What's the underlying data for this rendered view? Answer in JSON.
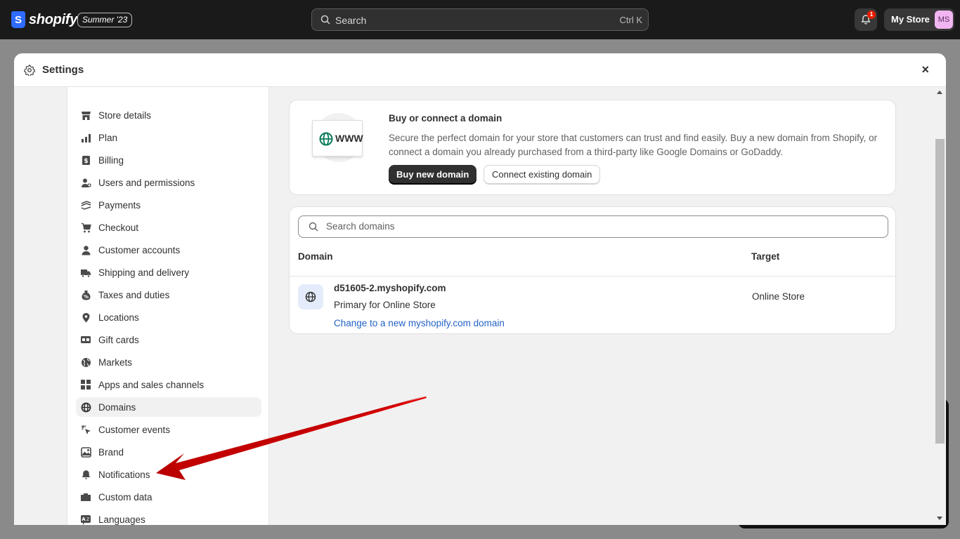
{
  "topbar": {
    "logo_mark": "S",
    "logo_text": "shopify",
    "edition": "Summer '23",
    "search_placeholder": "Search",
    "search_shortcut": "Ctrl K",
    "notification_count": "1",
    "store_name": "My Store",
    "avatar_initials": "MS"
  },
  "modal": {
    "title": "Settings",
    "close_label": "×"
  },
  "sidebar": {
    "items": [
      {
        "label": "Store details",
        "icon": "store-icon"
      },
      {
        "label": "Plan",
        "icon": "plan-icon"
      },
      {
        "label": "Billing",
        "icon": "billing-icon"
      },
      {
        "label": "Users and permissions",
        "icon": "users-icon"
      },
      {
        "label": "Payments",
        "icon": "payments-icon"
      },
      {
        "label": "Checkout",
        "icon": "cart-icon"
      },
      {
        "label": "Customer accounts",
        "icon": "person-icon"
      },
      {
        "label": "Shipping and delivery",
        "icon": "truck-icon"
      },
      {
        "label": "Taxes and duties",
        "icon": "tax-icon"
      },
      {
        "label": "Locations",
        "icon": "location-icon"
      },
      {
        "label": "Gift cards",
        "icon": "gift-card-icon"
      },
      {
        "label": "Markets",
        "icon": "globe-icon"
      },
      {
        "label": "Apps and sales channels",
        "icon": "apps-icon"
      },
      {
        "label": "Domains",
        "icon": "domain-globe-icon",
        "active": true
      },
      {
        "label": "Customer events",
        "icon": "cursor-icon"
      },
      {
        "label": "Brand",
        "icon": "brand-icon"
      },
      {
        "label": "Notifications",
        "icon": "bell-icon"
      },
      {
        "label": "Custom data",
        "icon": "custom-data-icon"
      },
      {
        "label": "Languages",
        "icon": "languages-icon"
      }
    ]
  },
  "domain_card": {
    "illustration_text": "WWW",
    "title": "Buy or connect a domain",
    "description": "Secure the perfect domain for your store that customers can trust and find easily. Buy a new domain from Shopify, or connect a domain you already purchased from a third-party like Google Domains or GoDaddy.",
    "primary_button": "Buy new domain",
    "secondary_button": "Connect existing domain"
  },
  "domains_table": {
    "search_placeholder": "Search domains",
    "columns": [
      "Domain",
      "Target"
    ],
    "rows": [
      {
        "domain": "d51605-2.myshopify.com",
        "subtitle": "Primary for Online Store",
        "link": "Change to a new myshopify.com domain",
        "target": "Online Store"
      }
    ]
  },
  "colors": {
    "topbar": "#1a1a1a",
    "accent_blue": "#2463c6",
    "annotation_arrow": "#d40000",
    "badge": "#e51c00"
  }
}
